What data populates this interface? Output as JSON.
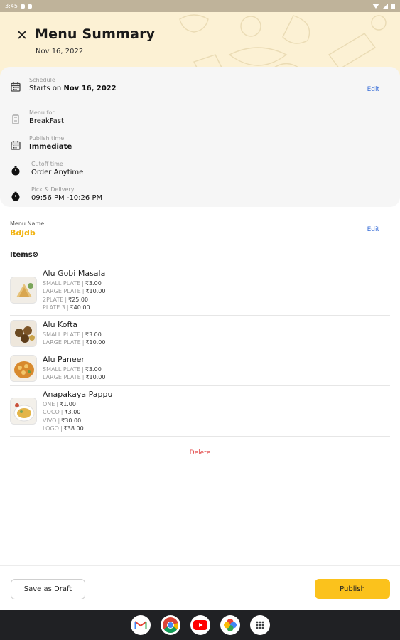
{
  "status_bar": {
    "time": "3:45"
  },
  "header": {
    "title": "Menu Summary",
    "date": "Nov 16, 2022"
  },
  "schedule_card": {
    "schedule": {
      "label": "Schedule",
      "prefix": "Starts on ",
      "value": "Nov 16, 2022",
      "edit_label": "Edit"
    },
    "menu_for": {
      "label": "Menu for",
      "value": "BreakFast"
    },
    "publish_time": {
      "label": "Publish time",
      "value": "Immediate"
    },
    "cutoff_time": {
      "label": "Cutoff time",
      "value": "Order Anytime"
    },
    "pick_delivery": {
      "label": "Pick & Delivery",
      "value": "09:56 PM -10:26 PM"
    }
  },
  "menu_name": {
    "label": "Menu Name",
    "value": "Bdjdb",
    "edit_label": "Edit"
  },
  "items_heading": "Items⊗",
  "items": [
    {
      "name": "Alu Gobi Masala",
      "variants": [
        {
          "name": "SMALL PLATE",
          "price": "₹3.00"
        },
        {
          "name": "LARGE PLATE",
          "price": "₹10.00"
        },
        {
          "name": "2PLATE",
          "price": "₹25.00"
        },
        {
          "name": "PLATE 3",
          "price": "₹40.00"
        }
      ]
    },
    {
      "name": "Alu Kofta",
      "variants": [
        {
          "name": "SMALL PLATE",
          "price": "₹3.00"
        },
        {
          "name": "LARGE PLATE",
          "price": "₹10.00"
        }
      ]
    },
    {
      "name": "Alu Paneer",
      "variants": [
        {
          "name": "SMALL PLATE",
          "price": "₹3.00"
        },
        {
          "name": "LARGE PLATE",
          "price": "₹10.00"
        }
      ]
    },
    {
      "name": "Anapakaya Pappu",
      "variants": [
        {
          "name": "ONE",
          "price": "₹1.00"
        },
        {
          "name": "COCO",
          "price": "₹3.00"
        },
        {
          "name": "VIVO",
          "price": "₹30.00"
        },
        {
          "name": "LOGO",
          "price": "₹38.00"
        }
      ]
    }
  ],
  "delete_label": "Delete",
  "bottom_bar": {
    "draft_label": "Save as Draft",
    "publish_label": "Publish"
  },
  "nav_apps": [
    "gmail-icon",
    "chrome-icon",
    "youtube-icon",
    "photos-icon",
    "app-drawer-icon"
  ],
  "colors": {
    "accent": "#fbc21c",
    "menu_name": "#f2b311",
    "edit_link": "#3a6fd8",
    "delete": "#e24747",
    "header_bg": "#fcf1d4"
  }
}
